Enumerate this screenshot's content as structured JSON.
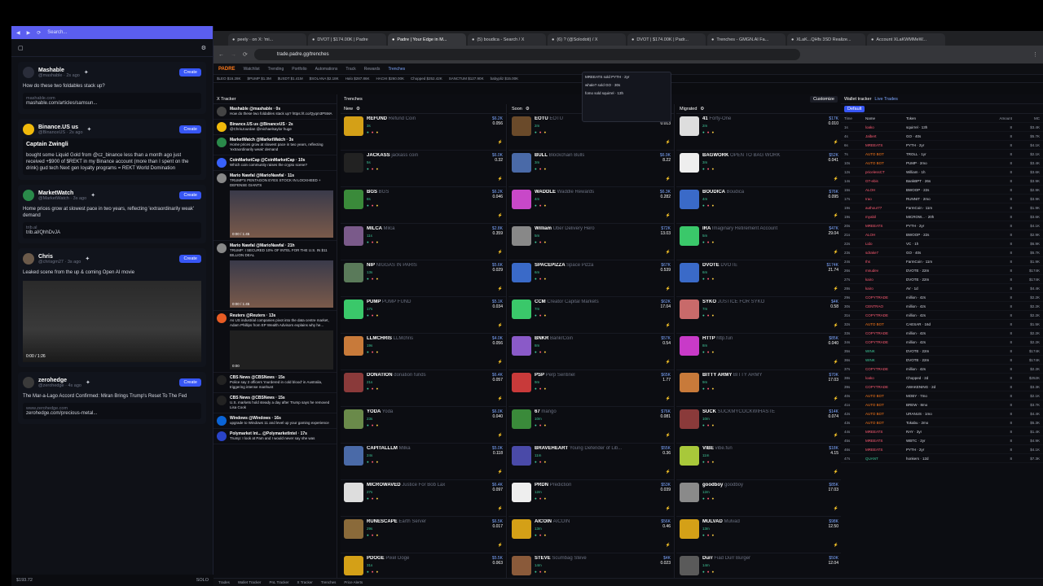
{
  "left_panel": {
    "search_placeholder": "Search...",
    "cards": [
      {
        "name": "Mashable",
        "handle": "@mashable · 2s ago",
        "text": "How do these two foldables stack up?",
        "link_label": "mashable.com",
        "link": "mashable.com/articles/samsun...",
        "avatar_color": "#2a2d3a"
      },
      {
        "name": "Binance.US us",
        "handle": "@BinanceUS · 2s ago",
        "text": "bought some Liquid Gold from @cz_binance less than a month ago just received +$900 of $REKT in my Binance account (more than I spent on the drink) gud tech Next gen loyalty programs = REKT World Domination",
        "quote_name": "Captain Zwingli",
        "avatar_color": "#f0b90b"
      },
      {
        "name": "MarketWatch",
        "handle": "@MarketWatch · 3s ago",
        "text": "Home prices grow at slowest pace in two years, reflecting 'extraordinarily weak' demand",
        "link_label": "trib.al",
        "link": "trib.al/QhhDvJA",
        "avatar_color": "#2a8a4a"
      },
      {
        "name": "Chris",
        "handle": "@chrisgm27 · 3s ago",
        "text": "Leaked scene from the up & coming Open AI movie",
        "video_time": "0:00 / 1:26",
        "avatar_color": "#6b5a4a"
      },
      {
        "name": "zerohedge",
        "handle": "@zerohedge · 4s ago",
        "text": "The Mar-a-Lago Accord Confirmed: Miran Brings Trump's Reset To The Fed",
        "link_label": "www.zerohedge.com",
        "link": "zerohedge.com/precious-metal...",
        "avatar_color": "#3a3a3a"
      }
    ],
    "create_label": "Create",
    "footer": {
      "balance": "$193.72",
      "mode": "SOLO"
    }
  },
  "browser": {
    "tabs": [
      "peely · on X: 'mi...",
      "DVOT | $174.00K | Padre",
      "Padre | Your Edge in M...",
      "(5) boudica - Search / X",
      "(6) ? (@Solodoti) / X",
      "DVOT | $174.00K | Padr...",
      "Trenches - GMGN.AI Fa...",
      "XLaK...QHfs 3SD Realize...",
      "Account XLaKWMMeW..."
    ],
    "url": "trade.padre.gg/trenches",
    "app_nav": [
      "Watchlist",
      "Trending",
      "Portfolio",
      "Automations",
      "Track",
      "Rewards",
      "Trenches"
    ],
    "logo": "PADRE",
    "ticker": [
      "$LEO $16.28K",
      "$PUMP $1.3M",
      "$USDT $1.41M",
      "$SOLANA $2.18K",
      "Halo $287.86K",
      "HACHI $260.00K",
      "Chopped $252.42K",
      "SANCTUM $127.90K",
      "babypliz $15.00K"
    ],
    "section_title": "Trenches",
    "customize_label": "Customize"
  },
  "tracker": {
    "title": "X Tracker",
    "items": [
      {
        "name": "Mashable",
        "handle": "@mashable · 0s",
        "text": "How do these two foldables stack up? https://t.co/Qyqm3P5MA",
        "color": "#444"
      },
      {
        "name": "Binance.US us",
        "handle": "@BinanceUS · 2s",
        "text": "@ChrisJourdan @michaelsaylor huge",
        "color": "#f0b90b"
      },
      {
        "name": "MarketWatch",
        "handle": "@MarketWatch · 3s",
        "text": "Home prices grow at slowest pace in two years, reflecting 'extraordinarily weak' demand",
        "color": "#2a8a4a"
      },
      {
        "name": "CoinMarketCap",
        "handle": "@CoinMarketCap · 10s",
        "text": "Which coin community raises the crypto scene?",
        "color": "#3861fb"
      },
      {
        "name": "Mario Nawfal",
        "handle": "@MarioNawfal · 11s",
        "text": "TRUMP'S PENTAGON EYES STOCK IN LOCKHEED + DEFENSE GIANTS",
        "color": "#888"
      },
      {
        "name": "Mario Nawfal",
        "handle": "@MarioNawfal · 21h",
        "text": "TRUMP: I SECURED 10% OF INTEL FOR THE U.S. IN $11 BILLION DEAL",
        "color": "#888"
      },
      {
        "name": "Reuters",
        "handle": "@Reuters · 13s",
        "text": "As US industrial companies pivot into the data centre market, Adam Phillips from EP Wealth Advisors explains why he...",
        "color": "#e85c24"
      },
      {
        "name": "CBS News",
        "handle": "@CBSNews · 15s",
        "text": "Police say 2 officers 'murdered in cold blood' in Australia, triggering intense manhunt",
        "color": "#222"
      },
      {
        "name": "CBS News",
        "handle": "@CBSNews · 15s",
        "text": "U.S. markets hold steady a day after Trump says he removed Lisa Cook",
        "color": "#222"
      },
      {
        "name": "Windows",
        "handle": "@Windows · 16s",
        "text": "upgrade to Windows 11 and level up your gaming experience",
        "color": "#0a64d6"
      },
      {
        "name": "Polymarket Int...",
        "handle": "@PolymarketIntel · 17s",
        "text": "Trump: I look at Pam and I would never say she was",
        "color": "#2a44c8"
      }
    ],
    "video_time_1": "0:00 / 1:45",
    "video_time_2": "0:00 / 1:45",
    "video_time_3": "0:00"
  },
  "columns": [
    {
      "title": "New",
      "tokens": [
        {
          "sym": "REFUND",
          "name": "Refund Coin",
          "mc": "$6.2K",
          "v": "0.056",
          "age": "3s",
          "color": "#d4a017"
        },
        {
          "sym": "JACKASS",
          "name": "jackass coin",
          "mc": "$6.0K",
          "v": "0.32",
          "age": "5s",
          "color": "#222"
        },
        {
          "sym": "BGS",
          "name": "BGS",
          "mc": "$6.2K",
          "v": "0.046",
          "age": "8s",
          "color": "#3a8a3a"
        },
        {
          "sym": "MILCA",
          "name": "Milca",
          "mc": "$2.8K",
          "v": "0.359",
          "age": "11s",
          "color": "#7a5a8a"
        },
        {
          "sym": "NIP",
          "name": "NIGGAS IN PARIS",
          "mc": "$5.6K",
          "v": "0.029",
          "age": "13s",
          "color": "#5a7a5a"
        },
        {
          "sym": "PUMP",
          "name": "PUMP FUND",
          "mc": "$5.1K",
          "v": "0.034",
          "age": "17s",
          "color": "#3ac86a"
        },
        {
          "sym": "LLMCHRIS",
          "name": "LLMchris",
          "mc": "$4.0K",
          "v": "0.056",
          "age": "19s",
          "color": "#c87a3a"
        },
        {
          "sym": "DONATION",
          "name": "donation funds",
          "mc": "$6.4K",
          "v": "0.057",
          "age": "21s",
          "color": "#8a3a3a"
        },
        {
          "sym": "YODA",
          "name": "Yoda",
          "mc": "$6.0K",
          "v": "0.040",
          "age": "23s",
          "color": "#6a8a4a"
        },
        {
          "sym": "CAPITALLLM",
          "name": "Milka",
          "mc": "$5.0K",
          "v": "0.118",
          "age": "24s",
          "color": "#4a6aa8"
        },
        {
          "sym": "MICROWAVED",
          "name": "Justice For Bob Lax",
          "mc": "$6.4K",
          "v": "0.097",
          "age": "27s",
          "color": "#ddd"
        },
        {
          "sym": "RUNESCAPE",
          "name": "Earth Server",
          "mc": "$6.5K",
          "v": "0.017",
          "age": "29s",
          "color": "#8a6a3a"
        },
        {
          "sym": "PDOGE",
          "name": "Pixel Doge",
          "mc": "$5.5K",
          "v": "0.063",
          "age": "31s",
          "color": "#d4a017"
        }
      ]
    },
    {
      "title": "Soon",
      "tokens": [
        {
          "sym": "EOTU",
          "name": "EOTU",
          "mc": "$71.0K",
          "v": "0.013",
          "age": "2m",
          "color": "#6a4a2a"
        },
        {
          "sym": "BULL",
          "name": "Blockchain Bulls",
          "mc": "$6.9K",
          "v": "8.22",
          "age": "3m",
          "color": "#4a6aa8"
        },
        {
          "sym": "WADDLE",
          "name": "Waddle Rewards",
          "mc": "$6.3K",
          "v": "0.282",
          "age": "4m",
          "color": "#c848c8"
        },
        {
          "sym": "William",
          "name": "Uber Delivery Hero",
          "mc": "$72K",
          "v": "13.03",
          "age": "5m",
          "color": "#888"
        },
        {
          "sym": "SPACEPIZZA",
          "name": "Space Pizza",
          "mc": "$67K",
          "v": "0.539",
          "age": "6m",
          "color": "#3a6ac8"
        },
        {
          "sym": "CCM",
          "name": "Creator Capital Markets",
          "mc": "$62K",
          "v": "17.04",
          "age": "7m",
          "color": "#3ac86a"
        },
        {
          "sym": "BNKR",
          "name": "BankrCoin",
          "mc": "$57K",
          "v": "0.54",
          "age": "8m",
          "color": "#8a5ac8"
        },
        {
          "sym": "PSP",
          "name": "Perp Sentinel",
          "mc": "$65K",
          "v": "1.77",
          "age": "9m",
          "color": "#c83a3a"
        },
        {
          "sym": "67",
          "name": "mango",
          "mc": "$76K",
          "v": "0.081",
          "age": "10m",
          "color": "#3a8a3a"
        },
        {
          "sym": "BRAVEHEART",
          "name": "Young Defender of Lib...",
          "mc": "$55K",
          "v": "0.36",
          "age": "11m",
          "color": "#4a4aa8"
        },
        {
          "sym": "PRDN",
          "name": "Prediction",
          "mc": "$53K",
          "v": "0.039",
          "age": "12m",
          "color": "#eee"
        },
        {
          "sym": "AICOIN",
          "name": "AICOIN",
          "mc": "$56K",
          "v": "0.46",
          "age": "13m",
          "color": "#d4a017"
        },
        {
          "sym": "STEVE",
          "name": "Scumbag Steve",
          "mc": "$4K",
          "v": "0.023",
          "age": "14m",
          "color": "#8a5a3a"
        }
      ]
    },
    {
      "title": "Migrated",
      "tokens": [
        {
          "sym": "41",
          "name": "Forty-One",
          "mc": "$17K",
          "v": "0.010",
          "age": "2m",
          "color": "#ddd"
        },
        {
          "sym": "BAGWORK",
          "name": "OPEN TO BAG WORK",
          "mc": "$52K",
          "v": "0.041",
          "age": "3m",
          "color": "#eee"
        },
        {
          "sym": "BOUDICA",
          "name": "Boudica",
          "mc": "$76K",
          "v": "0.095",
          "age": "4m",
          "color": "#3a6ac8"
        },
        {
          "sym": "IRA",
          "name": "Imaginary Retirement Account",
          "mc": "$47K",
          "v": "29.04",
          "age": "5m",
          "color": "#3ac86a"
        },
        {
          "sym": "DVOTE",
          "name": "DVOTE",
          "mc": "$174K",
          "v": "21.74",
          "age": "6m",
          "color": "#3a6ac8"
        },
        {
          "sym": "SYKO",
          "name": "JUSTICE FOR SYKO",
          "mc": "$4K",
          "v": "0.58",
          "age": "7m",
          "color": "#c86a6a"
        },
        {
          "sym": "HTTP",
          "name": "http.fun",
          "mc": "$85K",
          "v": "0.040",
          "age": "8m",
          "color": "#c83ac8"
        },
        {
          "sym": "BITTY ARMY",
          "name": "BITTY ARMY",
          "mc": "$70K",
          "v": "17.03",
          "age": "9m",
          "color": "#c87a3a"
        },
        {
          "sym": "SUCK",
          "name": "SUCKMYCOCKWIHASTE",
          "mc": "$14K",
          "v": "0.074",
          "age": "10m",
          "color": "#8a3a3a"
        },
        {
          "sym": "VIBE",
          "name": "vibe.fun",
          "mc": "$18K",
          "v": "4.15",
          "age": "11m",
          "color": "#a8c83a"
        },
        {
          "sym": "goodboy",
          "name": "goodboy",
          "mc": "$85K",
          "v": "17.03",
          "age": "12m",
          "color": "#8a8a8a"
        },
        {
          "sym": "MULVAD",
          "name": "Mulvad",
          "mc": "$98K",
          "v": "12.50",
          "age": "13m",
          "color": "#d4a017"
        },
        {
          "sym": "Durr",
          "name": "Fiad Durr Burger",
          "mc": "$50K",
          "v": "12.04",
          "age": "14m",
          "color": "#5a5a5a"
        }
      ]
    }
  ],
  "wallet": {
    "title": "Wallet tracker",
    "live": "Live Trades",
    "default_label": "Default",
    "headers": [
      "Time",
      "Name",
      "Token",
      "Amount",
      "MC"
    ],
    "rows": [
      [
        "1s",
        "loako",
        "squirrel · 13h",
        "8",
        "$3.4K"
      ],
      [
        "4s",
        "Jalbert",
        "GO · 40s",
        "8",
        "$5.7K"
      ],
      [
        "6s",
        "MREEATS",
        "PYTH · 2yr",
        "8",
        "$4.1K"
      ],
      [
        "7s",
        "AUTO BOT",
        "TROLL · 1yr",
        "8",
        "$2.1K"
      ],
      [
        "10s",
        "AUTO BOT",
        "PUMP · 2mo",
        "8",
        "$3.4K"
      ],
      [
        "12s",
        "pricelessCT",
        "William · 1h",
        "8",
        "$3.6K"
      ],
      [
        "14s",
        "GT-ebis",
        "BankBPT · 26s",
        "8",
        "$3.9K"
      ],
      [
        "15s",
        "ALOH",
        "BWOOP · 22s",
        "8",
        "$2.9K"
      ],
      [
        "17s",
        "Irao",
        "RUNNIT · 2mo",
        "8",
        "$3.9K"
      ],
      [
        "19s",
        "authour77",
        "FarmCoin · 11m",
        "8",
        "$1.9K"
      ],
      [
        "19s",
        "myabil",
        "MICROW... · 20h",
        "8",
        "$3.6K"
      ],
      [
        "20s",
        "MREEATS",
        "PYTH · 2yr",
        "8",
        "$4.1K"
      ],
      [
        "21s",
        "ALOH",
        "BWOOP · 22s",
        "8",
        "$2.9K"
      ],
      [
        "22s",
        "Lido",
        "VC · 1h",
        "8",
        "$6.9K"
      ],
      [
        "23s",
        "sdrake7",
        "GO · 40s",
        "8",
        "$5.7K"
      ],
      [
        "24s",
        "Ihs",
        "FarmCoin · 11m",
        "8",
        "$1.9K"
      ],
      [
        "26s",
        "mnudev",
        "DVOTE · 22m",
        "8",
        "$174K"
      ],
      [
        "27s",
        "kairo",
        "DVOTE · 22m",
        "8",
        "$174K"
      ],
      [
        "28s",
        "kairo",
        "AV · 1d",
        "8",
        "$4.4K"
      ],
      [
        "29s",
        "COPYTRADE",
        "million · 42s",
        "8",
        "$2.2K"
      ],
      [
        "30s",
        "CENTRAO",
        "million · 42s",
        "8",
        "$2.2K"
      ],
      [
        "31s",
        "COPYTRADE",
        "million · 42s",
        "8",
        "$2.2K"
      ],
      [
        "32s",
        "AUTO BOT",
        "CAESAR · 16d",
        "8",
        "$1.5K"
      ],
      [
        "33s",
        "COPYTRADE",
        "million · 42s",
        "8",
        "$2.2K"
      ],
      [
        "34s",
        "COPYTRADE",
        "million · 42s",
        "8",
        "$2.2K"
      ],
      [
        "35s",
        "WINK",
        "DVOTE · 22m",
        "8",
        "$174K"
      ],
      [
        "36s",
        "WINK",
        "DVOTE · 22m",
        "8",
        "$174K"
      ],
      [
        "37s",
        "COPYTRADE",
        "million · 42s",
        "8",
        "$2.2K"
      ],
      [
        "38s",
        "loako",
        "Chopped · 2d",
        "8",
        "$252K"
      ],
      [
        "39s",
        "COPYTRADE",
        "AWAKENING · 2d",
        "8",
        "$3.3K"
      ],
      [
        "40s",
        "AUTO BOT",
        "MOBY · 7mo",
        "8",
        "$2.1K"
      ],
      [
        "41s",
        "AUTO BOT",
        "BREW · 8mo",
        "8",
        "$3.7K"
      ],
      [
        "42s",
        "AUTO BOT",
        "URANUS · 1mo",
        "8",
        "$4.4K"
      ],
      [
        "43s",
        "AUTO BOT",
        "Tokabu · 2mo",
        "8",
        "$5.3K"
      ],
      [
        "44s",
        "MREEATS",
        "RAY · 3yr",
        "8",
        "$1.4K"
      ],
      [
        "45s",
        "MREEATS",
        "WBTC · 2yr",
        "8",
        "$4.9K"
      ],
      [
        "46s",
        "MREEATS",
        "PYTH · 2yr",
        "8",
        "$4.1K"
      ],
      [
        "47s",
        "QUANT",
        "honkers · 12d",
        "8",
        "$7.3K"
      ]
    ]
  },
  "popup": [
    "MREEATS sold PYTH · 2yr",
    "whale? sold GO · 30s",
    "fomo sold squirrel · 13h"
  ],
  "bottombar": [
    "Trades",
    "Wallet Tracker",
    "PnL Tracker",
    "X Tracker",
    "Trenches",
    "Price Alerts"
  ]
}
